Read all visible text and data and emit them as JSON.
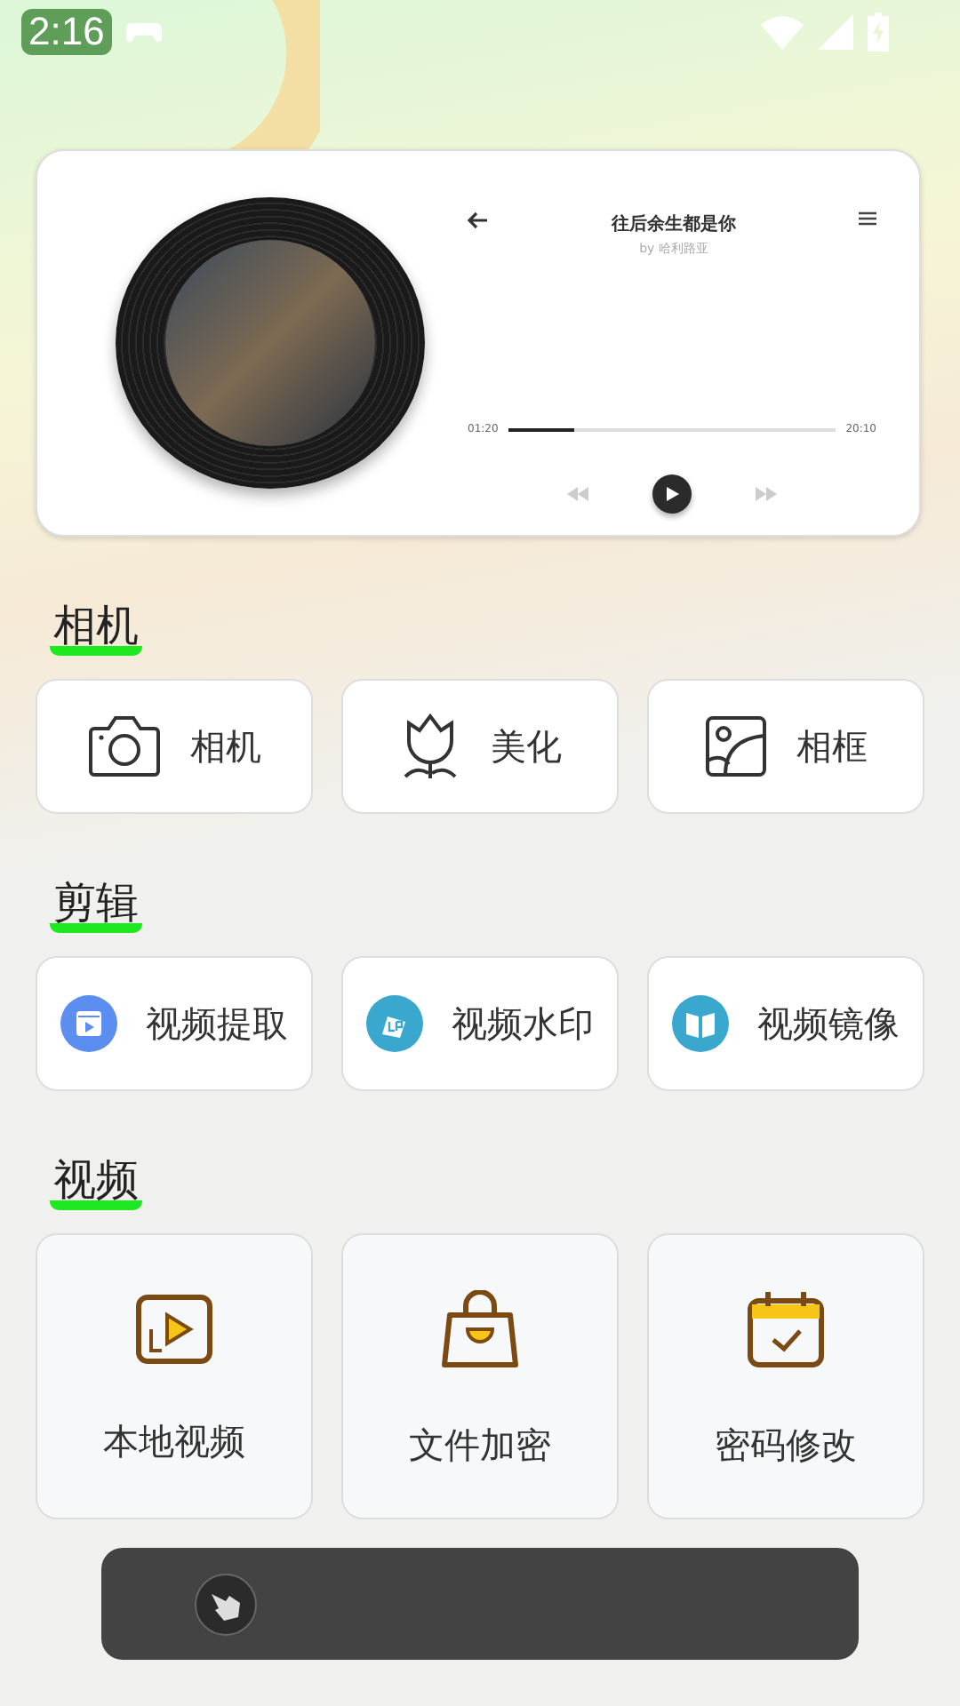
{
  "status_bar": {
    "time": "2:16"
  },
  "player": {
    "title": "往后余生都是你",
    "artist": "by 哈利路亚",
    "elapsed": "01:20",
    "total": "20:10",
    "progress": {
      "level": 0.2
    }
  },
  "sections": [
    {
      "title": "相机",
      "items": [
        {
          "label": "相机"
        },
        {
          "label": "美化"
        },
        {
          "label": "相框"
        }
      ]
    },
    {
      "title": "剪辑",
      "items": [
        {
          "label": "视频提取"
        },
        {
          "label": "视频水印"
        },
        {
          "label": "视频镜像"
        }
      ]
    },
    {
      "title": "视频",
      "items": [
        {
          "label": "本地视频"
        },
        {
          "label": "文件加密"
        },
        {
          "label": "密码修改"
        }
      ]
    }
  ]
}
